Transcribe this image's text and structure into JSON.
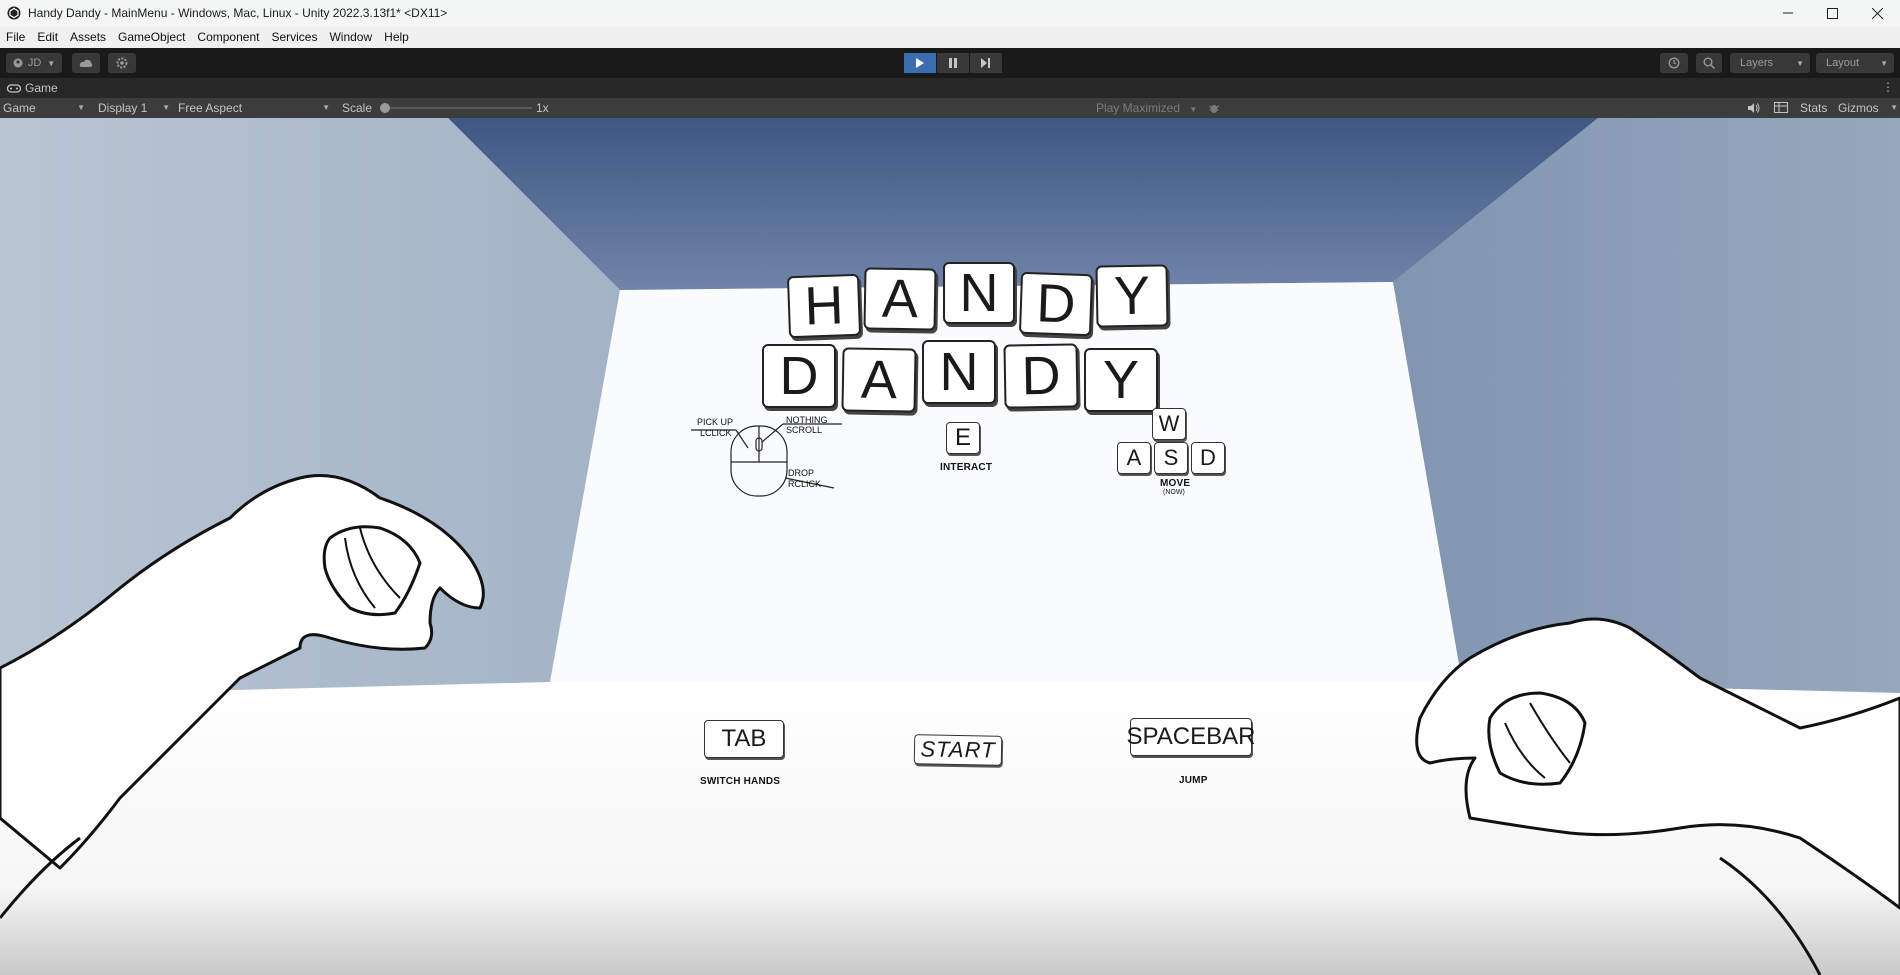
{
  "window": {
    "title": "Handy Dandy - MainMenu - Windows, Mac, Linux - Unity 2022.3.13f1* <DX11>"
  },
  "menu": [
    "File",
    "Edit",
    "Assets",
    "GameObject",
    "Component",
    "Services",
    "Window",
    "Help"
  ],
  "toolbar": {
    "account": "JD",
    "layers": "Layers",
    "layout": "Layout"
  },
  "tab": {
    "label": "Game"
  },
  "gamebar": {
    "mode": "Game",
    "display": "Display 1",
    "aspect": "Free Aspect",
    "scale_label": "Scale",
    "scale_value": "1x",
    "play_mode": "Play Maximized",
    "stats": "Stats",
    "gizmos": "Gizmos"
  },
  "game": {
    "title_row1": [
      "H",
      "A",
      "N",
      "D",
      "Y"
    ],
    "title_row2": [
      "D",
      "A",
      "N",
      "D",
      "Y"
    ],
    "mouse": {
      "pickup": "PICK UP",
      "lclick": "LCLICK",
      "nothing": "NOTHING",
      "scroll": "SCROLL",
      "drop": "DROP",
      "rclick": "RCLICK"
    },
    "interact_key": "E",
    "interact_label": "INTERACT",
    "move_keys": {
      "w": "W",
      "a": "A",
      "s": "S",
      "d": "D"
    },
    "move_label": "MOVE",
    "move_sub": "(NOW)",
    "tab_key": "TAB",
    "tab_label": "SWITCH HANDS",
    "start": "START",
    "space_key": "SPACEBAR",
    "space_label": "JUMP"
  },
  "colors": {
    "play_active": "#3a6eb0",
    "toolbar_bg": "#191919",
    "gamebar_bg": "#3c3c3c"
  }
}
